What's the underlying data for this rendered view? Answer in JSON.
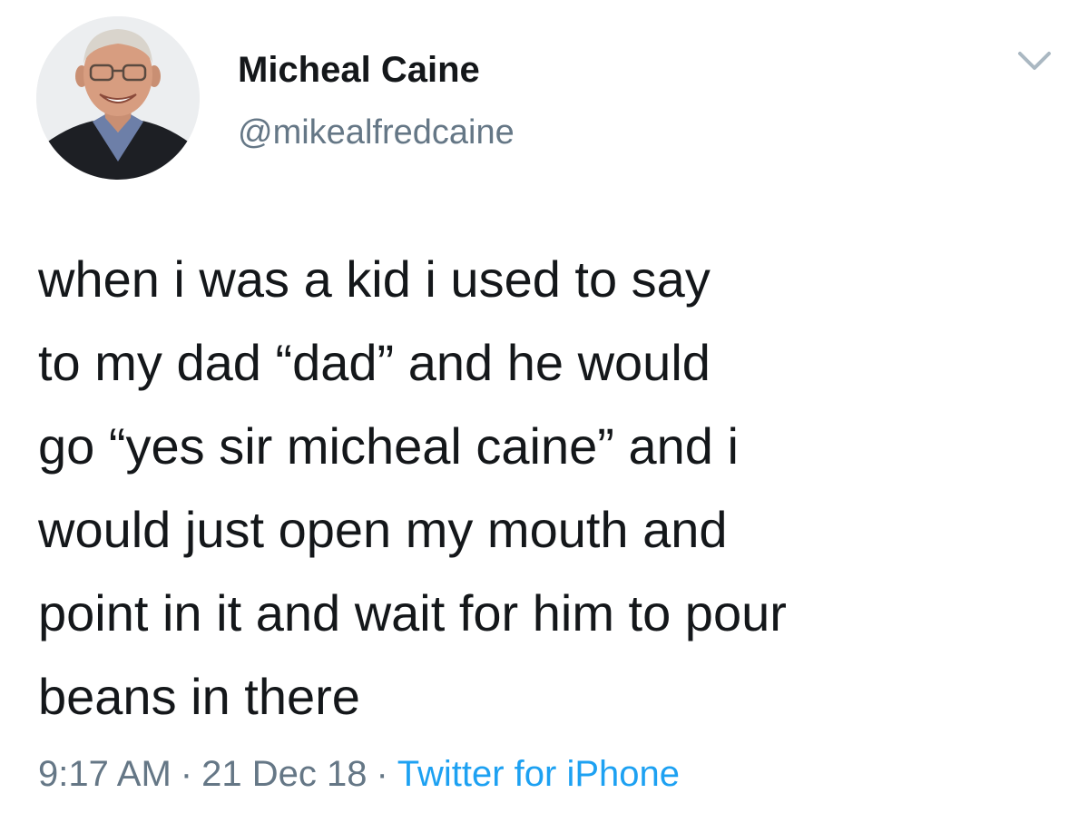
{
  "author": {
    "display_name": "Micheal Caine",
    "handle": "@mikealfredcaine"
  },
  "tweet": {
    "text": "when i was a kid i used to say\nto my dad “dad” and he would\ngo “yes sir micheal caine” and i\nwould just open my mouth and\npoint in it and wait for him to pour\nbeans in there",
    "time": "9:17 AM",
    "date": "21 Dec 18",
    "separator": "·",
    "source": "Twitter for iPhone"
  },
  "icons": {
    "menu": "chevron-down-icon",
    "avatar": "profile-avatar"
  },
  "colors": {
    "text": "#14171a",
    "secondary": "#657786",
    "link": "#1da1f2",
    "chevron": "#aab8c2"
  }
}
